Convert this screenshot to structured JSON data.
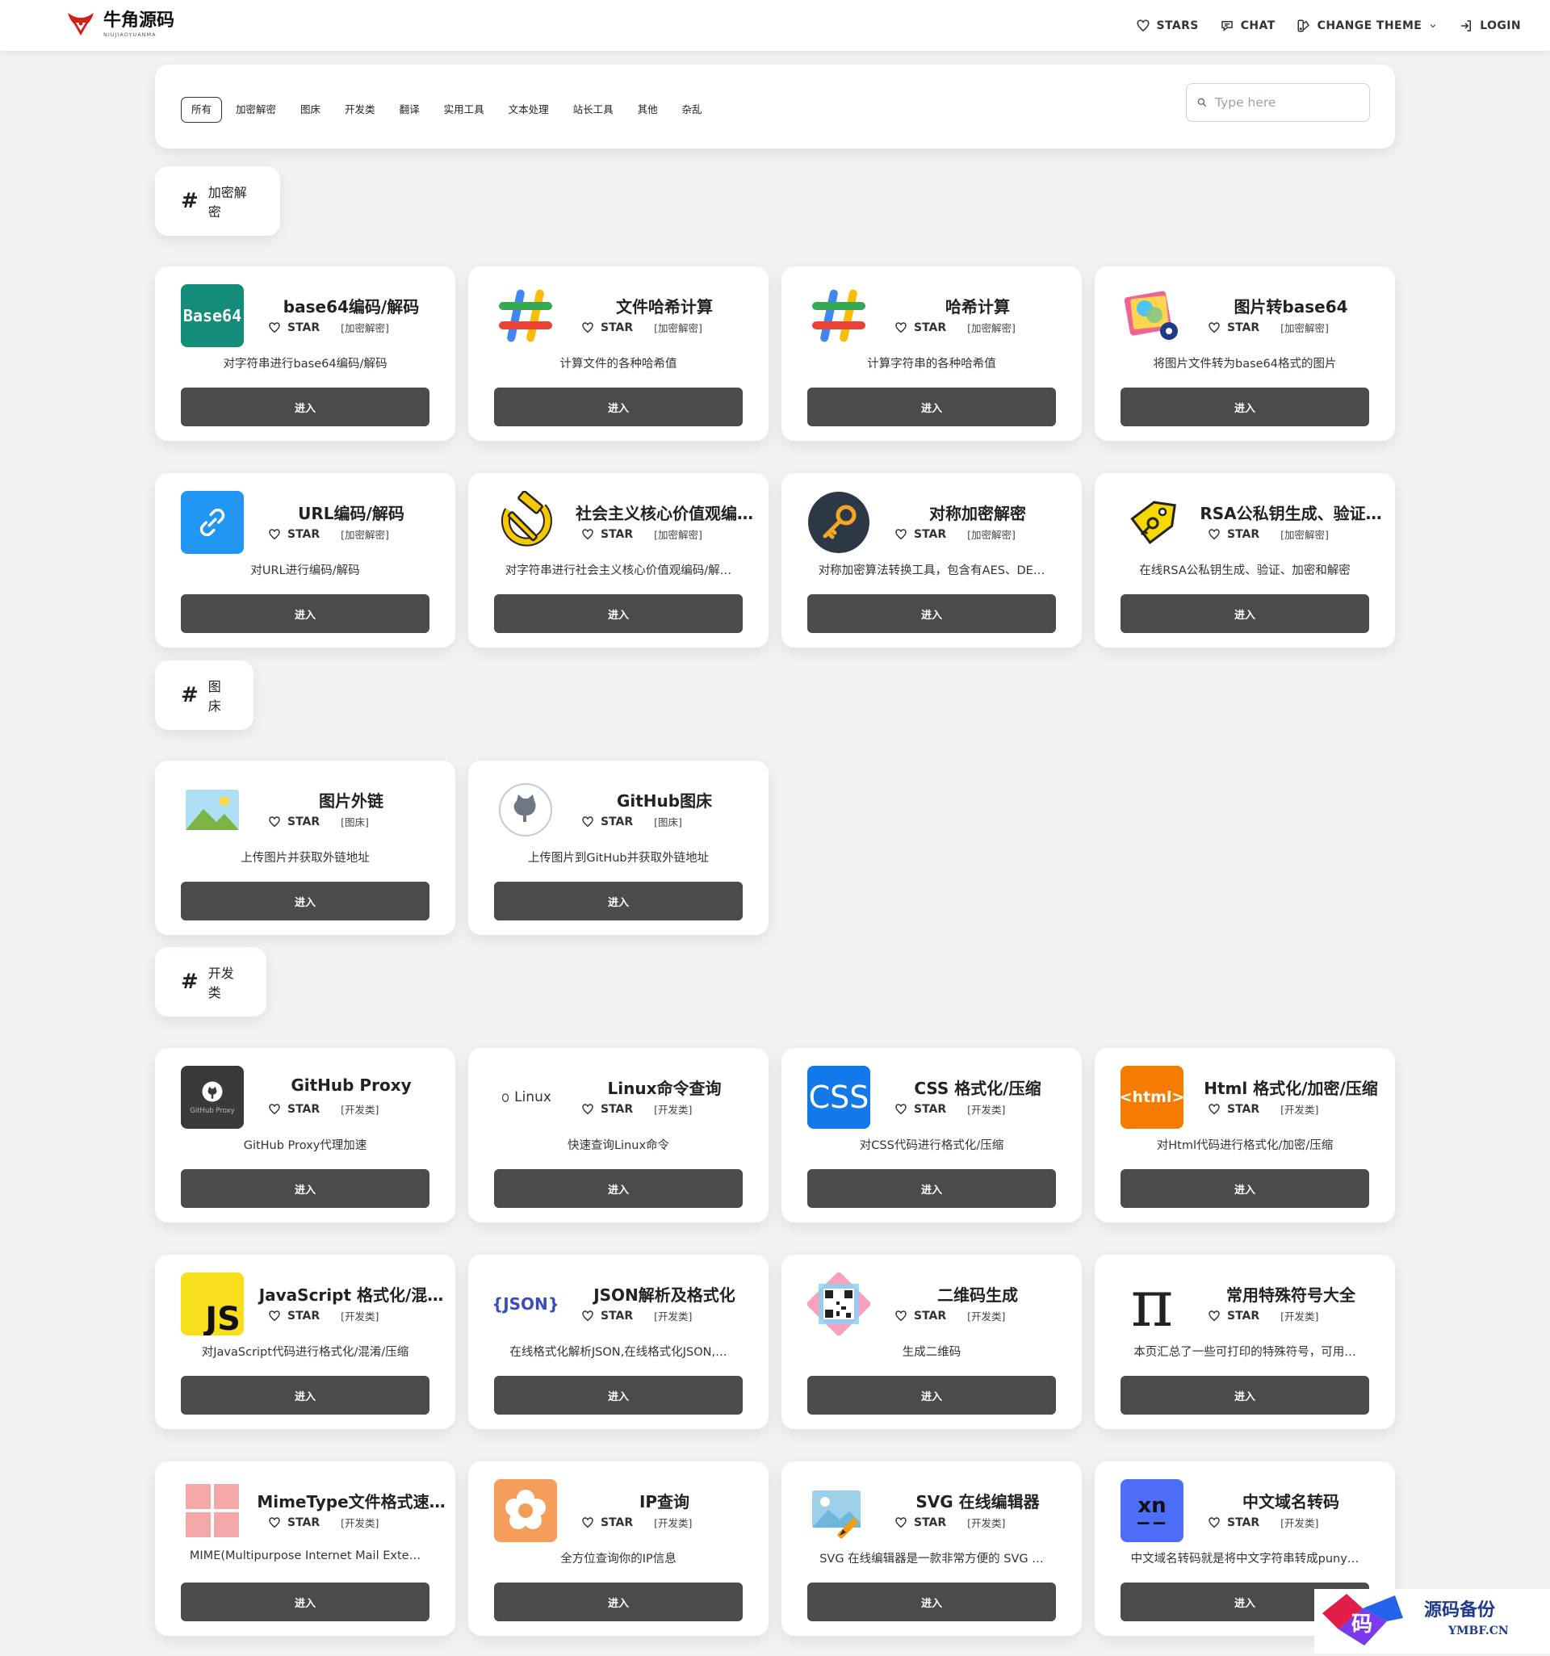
{
  "brand": {
    "name": "牛角源码",
    "sub": "NIUJIAOYUANMA"
  },
  "nav": {
    "stars": "STARS",
    "chat": "CHAT",
    "theme": "CHANGE THEME",
    "login": "LOGIN"
  },
  "filter": {
    "tabs": [
      "所有",
      "加密解密",
      "图床",
      "开发类",
      "翻译",
      "实用工具",
      "文本处理",
      "站长工具",
      "其他",
      "杂乱"
    ],
    "search_placeholder": "Type here"
  },
  "star_label": "STAR",
  "enter_label": "进入",
  "sections": [
    {
      "title": "加密解密",
      "items": [
        {
          "title": "base64编码/解码",
          "tag": "[加密解密]",
          "desc": "对字符串进行base64编码/解码",
          "icon": "base64-icon",
          "icon_text": "Base64"
        },
        {
          "title": "文件哈希计算",
          "tag": "[加密解密]",
          "desc": "计算文件的各种哈希值",
          "icon": "hash-icon"
        },
        {
          "title": "哈希计算",
          "tag": "[加密解密]",
          "desc": "计算字符串的各种哈希值",
          "icon": "hash-icon"
        },
        {
          "title": "图片转base64",
          "tag": "[加密解密]",
          "desc": "将图片文件转为base64格式的图片",
          "icon": "image-convert-icon"
        },
        {
          "title": "URL编码/解码",
          "tag": "[加密解密]",
          "desc": "对URL进行编码/解码",
          "icon": "link-icon"
        },
        {
          "title": "社会主义核心价值观编…",
          "tag": "[加密解密]",
          "desc": "对字符串进行社会主义核心价值观编码/解…",
          "icon": "hammer-sickle-icon"
        },
        {
          "title": "对称加密解密",
          "tag": "[加密解密]",
          "desc": "对称加密算法转换工具，包含有AES、DE…",
          "icon": "key-icon"
        },
        {
          "title": "RSA公私钥生成、验证…",
          "tag": "[加密解密]",
          "desc": "在线RSA公私钥生成、验证、加密和解密",
          "icon": "key-tag-icon"
        }
      ]
    },
    {
      "title": "图床",
      "items": [
        {
          "title": "图片外链",
          "tag": "[图床]",
          "desc": "上传图片并获取外链地址",
          "icon": "landscape-image-icon"
        },
        {
          "title": "GitHub图床",
          "tag": "[图床]",
          "desc": "上传图片到GitHub并获取外链地址",
          "icon": "github-cat-icon"
        }
      ]
    },
    {
      "title": "开发类",
      "items": [
        {
          "title": "GitHub Proxy",
          "tag": "[开发类]",
          "desc": "GitHub Proxy代理加速",
          "icon": "github-proxy-icon",
          "icon_text": "GitHub Proxy"
        },
        {
          "title": "Linux命令查询",
          "tag": "[开发类]",
          "desc": "快速查询Linux命令",
          "icon": "linux-icon",
          "icon_text": "Linux"
        },
        {
          "title": "CSS 格式化/压缩",
          "tag": "[开发类]",
          "desc": "对CSS代码进行格式化/压缩",
          "icon": "css-icon",
          "icon_text": "CSS"
        },
        {
          "title": "Html 格式化/加密/压缩",
          "tag": "[开发类]",
          "desc": "对Html代码进行格式化/加密/压缩",
          "icon": "html-icon",
          "icon_text": "<html>"
        },
        {
          "title": "JavaScript 格式化/混…",
          "tag": "[开发类]",
          "desc": "对JavaScript代码进行格式化/混淆/压缩",
          "icon": "js-icon",
          "icon_text": "JS"
        },
        {
          "title": "JSON解析及格式化",
          "tag": "[开发类]",
          "desc": "在线格式化解析JSON,在线格式化JSON,…",
          "icon": "json-icon",
          "icon_text": "{JSON}"
        },
        {
          "title": "二维码生成",
          "tag": "[开发类]",
          "desc": "生成二维码",
          "icon": "qrcode-icon"
        },
        {
          "title": "常用特殊符号大全",
          "tag": "[开发类]",
          "desc": "本页汇总了一些可打印的特殊符号，可用…",
          "icon": "pi-icon",
          "icon_text": "π"
        },
        {
          "title": "MimeType文件格式速…",
          "tag": "[开发类]",
          "desc": "MIME(Multipurpose Internet Mail Exte…",
          "icon": "grid-icon"
        },
        {
          "title": "IP查询",
          "tag": "[开发类]",
          "desc": "全方位查询你的IP信息",
          "icon": "ip-flower-icon"
        },
        {
          "title": "SVG 在线编辑器",
          "tag": "[开发类]",
          "desc": "SVG 在线编辑器是一款非常方便的 SVG …",
          "icon": "svg-editor-icon"
        },
        {
          "title": "中文域名转码",
          "tag": "[开发类]",
          "desc": "中文域名转码就是将中文字符串转成puny…",
          "icon": "punycode-icon",
          "icon_text": "xn"
        }
      ]
    }
  ],
  "watermark": {
    "text": "源码备份",
    "domain": "YMBF.CN",
    "badge": "码"
  }
}
